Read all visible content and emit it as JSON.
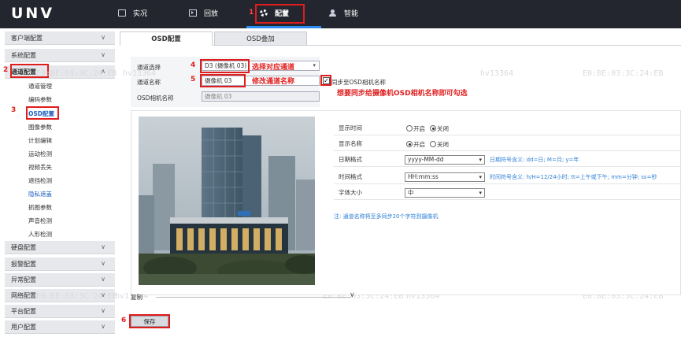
{
  "app": {
    "logo": "UNV"
  },
  "nav": {
    "items": [
      {
        "label": "实况",
        "icon": "monitor-icon"
      },
      {
        "label": "回放",
        "icon": "playback-icon"
      },
      {
        "label": "配置",
        "icon": "gear-icon"
      },
      {
        "label": "智能",
        "icon": "person-icon"
      }
    ],
    "active": "配置"
  },
  "sidebar": {
    "groups": [
      {
        "label": "客户端配置"
      },
      {
        "label": "系统配置"
      },
      {
        "label": "通道配置"
      },
      {
        "label": "硬盘配置"
      },
      {
        "label": "报警配置"
      },
      {
        "label": "异常配置"
      },
      {
        "label": "网络配置"
      },
      {
        "label": "平台配置"
      },
      {
        "label": "用户配置"
      }
    ],
    "subitems": [
      "通道管理",
      "编码参数",
      "OSD配置",
      "图像参数",
      "计划编辑",
      "运动检测",
      "视频丢失",
      "遮挡检测",
      "隐私遮盖",
      "抓图参数",
      "声音检测",
      "人形检测"
    ]
  },
  "tabs": {
    "active": "OSD配置",
    "inactive": "OSD叠加"
  },
  "form": {
    "channel_select_label": "通道选择",
    "channel_select_value": "D3 (摄像机 03)",
    "channel_name_label": "通道名称",
    "channel_name_value": "摄像机 03",
    "sync_label": "同步至OSD相机名称",
    "sync_checked": true,
    "osd_cam_name_label": "OSD相机名称",
    "osd_cam_name_value": "摄像机 03"
  },
  "settings": {
    "show_time_label": "显示时间",
    "show_name_label": "显示名称",
    "on_label": "开启",
    "off_label": "关闭",
    "show_time_value": "关闭",
    "show_name_value": "开启",
    "date_format_label": "日期格式",
    "date_format_value": "yyyy-MM-dd",
    "date_format_hint": "日期符号含义: dd=日; M=月; y=年",
    "time_format_label": "时间格式",
    "time_format_value": "HH:mm:ss",
    "time_format_hint": "时间符号含义: h/H=12/24小时; tt=上午或下午; mm=分钟; ss=秒",
    "font_size_label": "字体大小",
    "font_size_value": "中",
    "note": "注: 通道名称将至多同步20个字符到摄像机"
  },
  "watermark": {
    "mac": "E0:BE:03:3C:24:EB",
    "id": "hv13364"
  },
  "footer": {
    "copy_label": "复制",
    "save_label": "保存"
  },
  "annotations": {
    "n1": "1",
    "n2": "2",
    "n3": "3",
    "n4": "4",
    "n5": "5",
    "n6": "6",
    "select_channel": "选择对应通道",
    "rename_channel": "修改通道名称",
    "sync_hint": "想要同步给摄像机OSD相机名称即可勾选"
  },
  "colors": {
    "topbar": "#23262e",
    "accent": "#2d8cf0",
    "annotation_red": "#e01d1d",
    "hint_blue": "#2d7fd6"
  }
}
